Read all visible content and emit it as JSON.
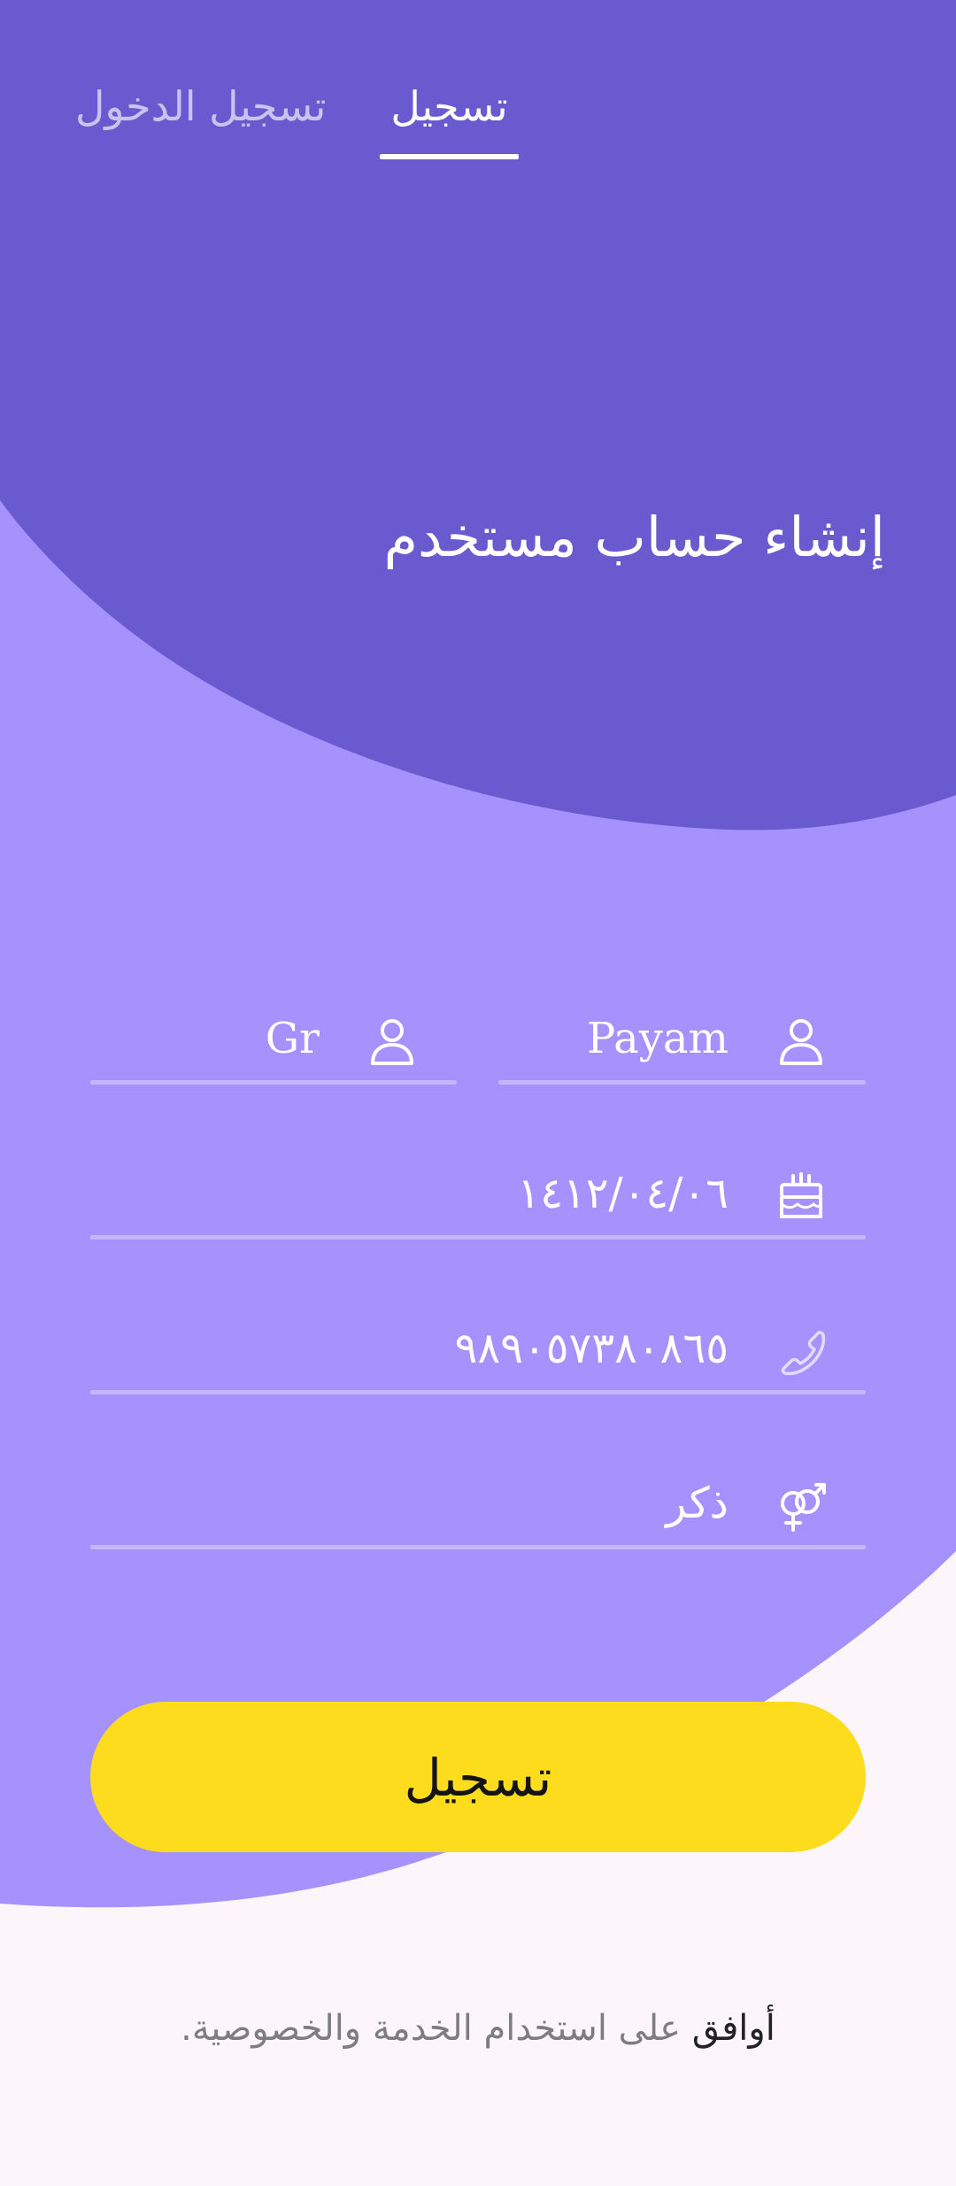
{
  "tabs": {
    "signup_label": "تسجيل",
    "login_label": "تسجيل الدخول"
  },
  "header": {
    "title": "إنشاء حساب مستخدم"
  },
  "form": {
    "first_name": {
      "value": "Payam",
      "icon": "person-icon"
    },
    "last_name": {
      "value": "Gr",
      "icon": "person-icon"
    },
    "birthdate": {
      "value": "١٤١٢/٠٤/٠٦",
      "icon": "birthday-cake-icon"
    },
    "phone": {
      "value": "٩٨٩٠٥٧٣٨٠٨٦٥",
      "icon": "phone-icon"
    },
    "gender": {
      "value": "ذكر",
      "icon": "gender-icon"
    }
  },
  "submit_label": "تسجيل",
  "terms": {
    "agree_word": "أوافق",
    "rest_text": " على استخدام الخدمة والخصوصية."
  },
  "colors": {
    "header_purple": "#6a5acf",
    "body_purple": "#a692fc",
    "background": "#fcf6fb",
    "button_yellow": "#fcdc1c"
  }
}
